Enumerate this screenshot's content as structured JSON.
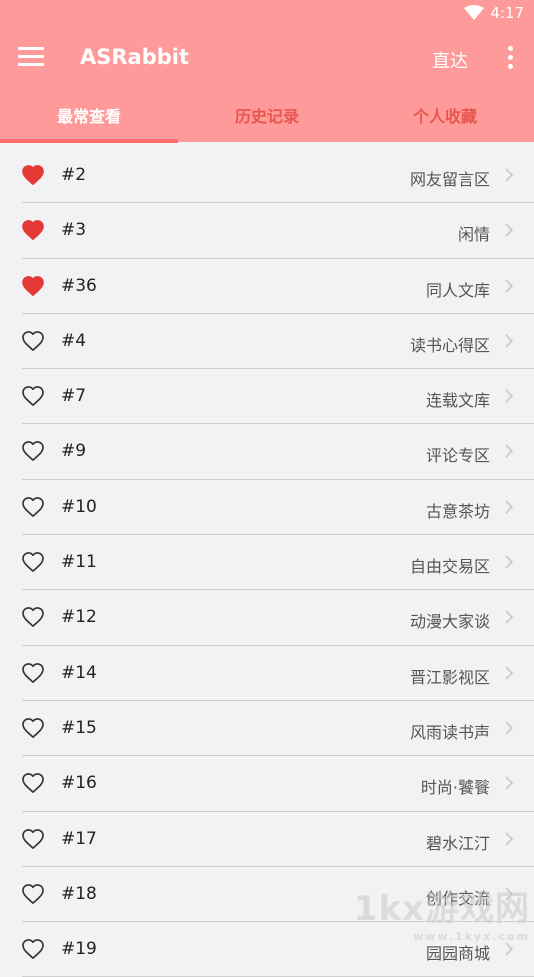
{
  "status_bar": {
    "time": "4:17"
  },
  "app_bar": {
    "title": "ASRabbit",
    "direct_label": "直达"
  },
  "tabs": [
    {
      "label": "最常查看"
    },
    {
      "label": "历史记录"
    },
    {
      "label": "个人收藏"
    }
  ],
  "items": [
    {
      "num": "#2",
      "forum": "网友留言区",
      "favorite": true
    },
    {
      "num": "#3",
      "forum": "闲情",
      "favorite": true
    },
    {
      "num": "#36",
      "forum": "同人文库",
      "favorite": true
    },
    {
      "num": "#4",
      "forum": "读书心得区",
      "favorite": false
    },
    {
      "num": "#7",
      "forum": "连载文库",
      "favorite": false
    },
    {
      "num": "#9",
      "forum": "评论专区",
      "favorite": false
    },
    {
      "num": "#10",
      "forum": "古意茶坊",
      "favorite": false
    },
    {
      "num": "#11",
      "forum": "自由交易区",
      "favorite": false
    },
    {
      "num": "#12",
      "forum": "动漫大家谈",
      "favorite": false
    },
    {
      "num": "#14",
      "forum": "晋江影视区",
      "favorite": false
    },
    {
      "num": "#15",
      "forum": "风雨读书声",
      "favorite": false
    },
    {
      "num": "#16",
      "forum": "时尚·饕餮",
      "favorite": false
    },
    {
      "num": "#17",
      "forum": "碧水江汀",
      "favorite": false
    },
    {
      "num": "#18",
      "forum": "创作交流",
      "favorite": false
    },
    {
      "num": "#19",
      "forum": "园园商城",
      "favorite": false
    }
  ],
  "colors": {
    "accent": "#ff9a9a",
    "heart": "#e53935",
    "indicator": "#ff6b6b"
  },
  "watermark": {
    "text": "1kx游戏网",
    "url": "www.1kyx.com"
  }
}
